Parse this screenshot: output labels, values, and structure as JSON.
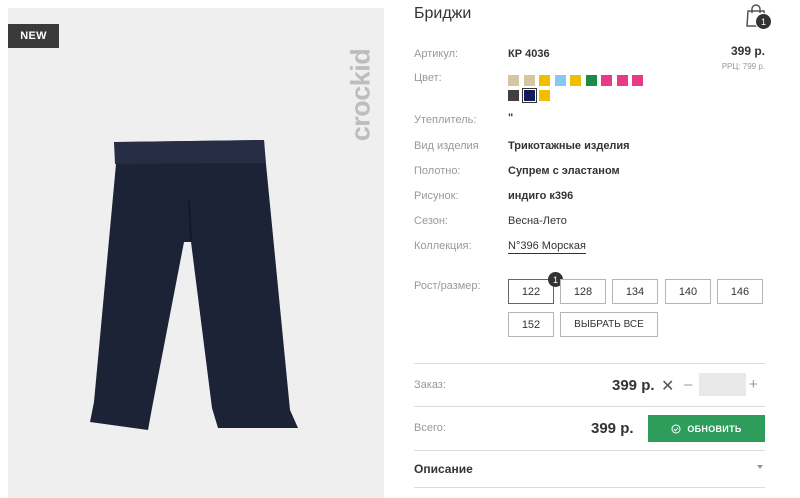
{
  "product": {
    "badge": "NEW",
    "brand": "crockid",
    "title": "Бриджи",
    "cart_count": "1"
  },
  "price": {
    "value": "399 р.",
    "rrp": "РРЦ: 799 р."
  },
  "attributes": {
    "article_label": "Артикул:",
    "article_value": "КР 4036",
    "color_label": "Цвет:",
    "insulation_label": "Утеплитель:",
    "insulation_value": "\"",
    "type_label": "Вид изделия",
    "type_value": "Трикотажные изделия",
    "fabric_label": "Полотно:",
    "fabric_value": "Супрем с эластаном",
    "pattern_label": "Рисунок:",
    "pattern_value": "индиго к396",
    "season_label": "Сезон:",
    "season_value": "Весна-Лето",
    "collection_label": "Коллекция:",
    "collection_value": "N°396 Морская"
  },
  "swatches": [
    {
      "color": "#d6c5a3"
    },
    {
      "color": "#d6c5a3"
    },
    {
      "color": "#f0c000"
    },
    {
      "color": "#88c8ef"
    },
    {
      "color": "#f0c000"
    },
    {
      "color": "#1e8a48"
    },
    {
      "color": "#e83a86"
    },
    {
      "color": "#e83a86"
    },
    {
      "color": "#e83a86"
    },
    {
      "color": "#404040"
    },
    {
      "color": "#141a5a",
      "selected": true
    },
    {
      "color": "#f0c000"
    }
  ],
  "sizes": {
    "label": "Рост/размер:",
    "options": [
      "122",
      "128",
      "134",
      "140",
      "146",
      "152"
    ],
    "selected_badge": "1",
    "select_all": "ВЫБРАТЬ ВСЕ"
  },
  "order": {
    "label": "Заказ:",
    "price": "399 р.",
    "remove": "✕",
    "minus": "–",
    "plus": "+",
    "quantity": ""
  },
  "total": {
    "label": "Всего:",
    "price": "399 р.",
    "update_button": "ОБНОВИТЬ"
  },
  "description": {
    "label": "Описание"
  }
}
